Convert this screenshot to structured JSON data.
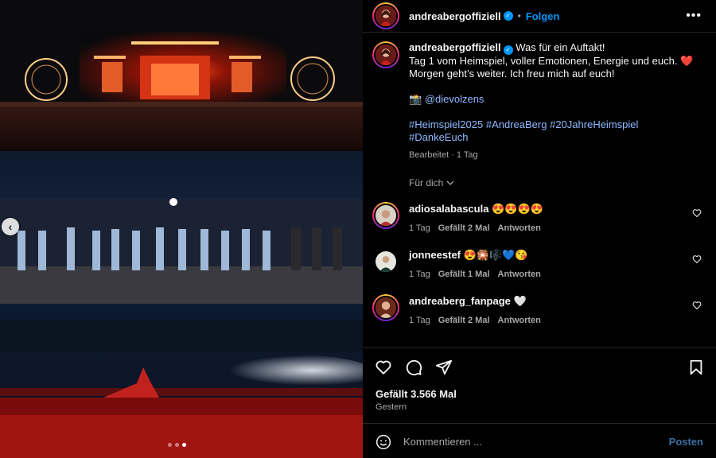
{
  "post": {
    "username": "andreabergoffiziell",
    "verified": true,
    "follow_label": "Folgen",
    "separator": "•",
    "more_label": "•••",
    "caption": {
      "line1": "Was für ein Auftakt!",
      "line2": "Tag 1 vom Heimspiel, voller Emotionen, Energie und euch. ❤️",
      "line3": "Morgen geht’s weiter. Ich freu mich auf euch!",
      "credit_emoji": "📸",
      "credit_mention": "@dievolzens",
      "hashtags": [
        "#Heimspiel2025",
        "#AndreaBerg",
        "#20JahreHeimspiel",
        "#DankeEuch"
      ],
      "meta": "Bearbeitet · 1 Tag"
    },
    "for_you_label": "Für dich"
  },
  "comments": [
    {
      "username": "adiosalabascula",
      "text": "😍😍😍😍",
      "time": "1 Tag",
      "likes": "Gefällt 2 Mal",
      "reply": "Antworten"
    },
    {
      "username": "jonneestef",
      "text": "😍🎇🎼💙😘",
      "time": "1 Tag",
      "likes": "Gefällt 1 Mal",
      "reply": "Antworten"
    },
    {
      "username": "andreaberg_fanpage",
      "text": "🤍",
      "time": "1 Tag",
      "likes": "Gefällt 2 Mal",
      "reply": "Antworten"
    }
  ],
  "footer": {
    "likes": "Gefällt 3.566 Mal",
    "date": "Gestern",
    "comment_placeholder": "Kommentieren ...",
    "post_label": "Posten"
  },
  "carousel": {
    "prev_label": "‹",
    "dot_count": 3,
    "active_dot": 2
  },
  "colors": {
    "accent": "#0095f6",
    "hashtag": "#8fb8ff",
    "muted": "#a8a8a8"
  }
}
